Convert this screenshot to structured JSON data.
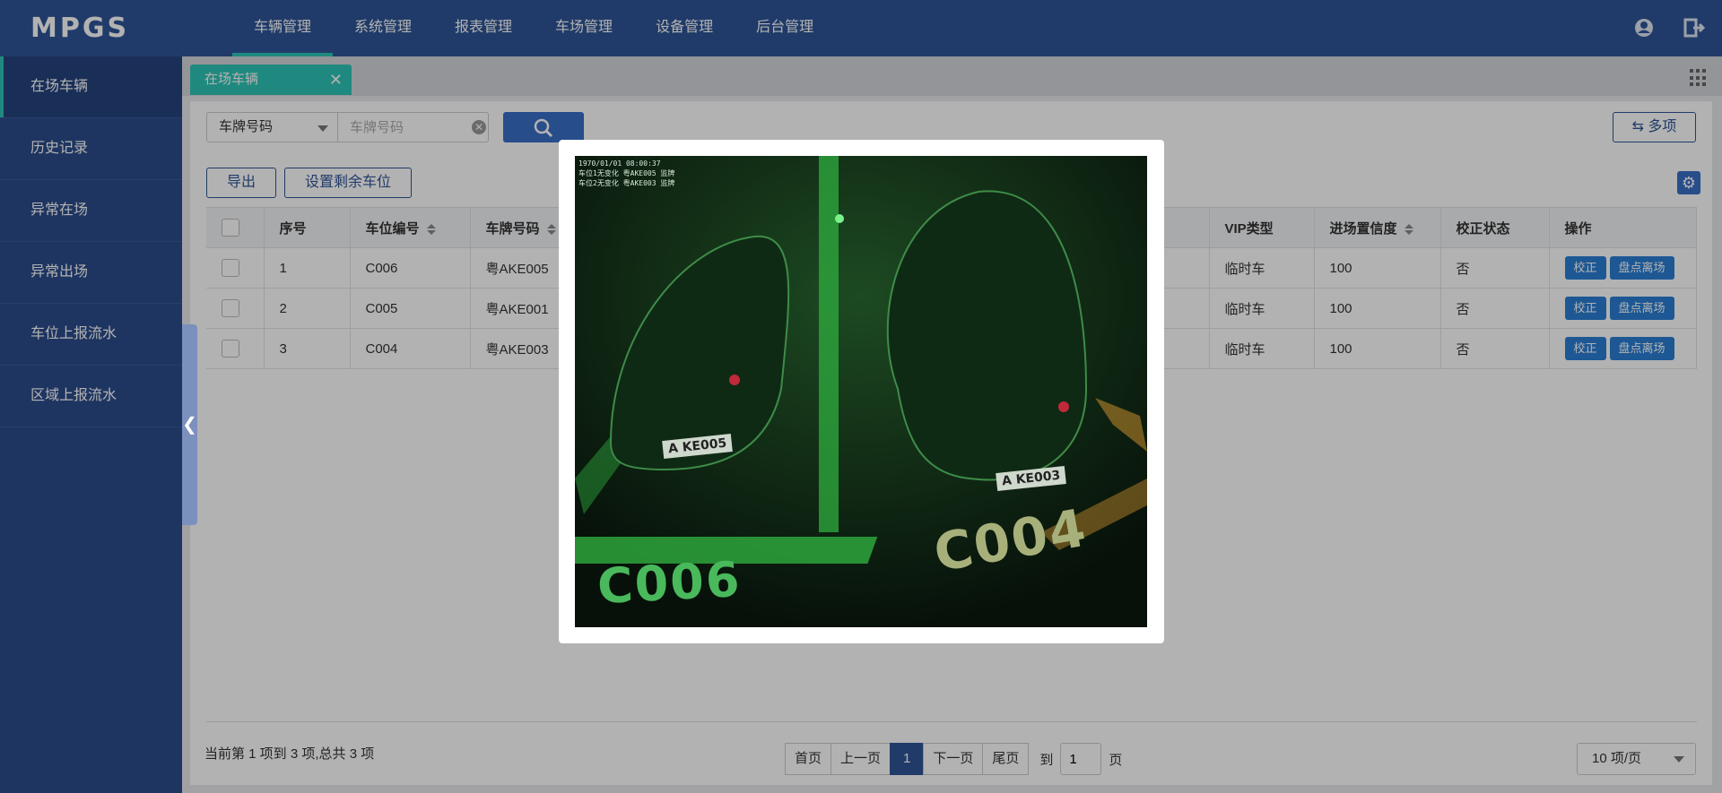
{
  "app": {
    "logo": "MPGS"
  },
  "topnav": {
    "items": [
      {
        "label": "车辆管理",
        "active": true
      },
      {
        "label": "系统管理"
      },
      {
        "label": "报表管理"
      },
      {
        "label": "车场管理"
      },
      {
        "label": "设备管理"
      },
      {
        "label": "后台管理"
      }
    ],
    "icons": [
      "user-icon",
      "logout-icon"
    ]
  },
  "sidebar": {
    "items": [
      {
        "label": "在场车辆",
        "active": true
      },
      {
        "label": "历史记录"
      },
      {
        "label": "异常在场"
      },
      {
        "label": "异常出场"
      },
      {
        "label": "车位上报流水"
      },
      {
        "label": "区域上报流水"
      }
    ],
    "collapse_glyph": "❮"
  },
  "tabs": [
    {
      "label": "在场车辆",
      "close": "✕"
    }
  ],
  "search": {
    "field_select": "车牌号码",
    "placeholder": "车牌号码",
    "clear_glyph": "✕",
    "multi_label": "⇆ 多项"
  },
  "toolbar": {
    "export_label": "导出",
    "set_remaining_label": "设置剩余车位",
    "gear_glyph": "⚙"
  },
  "table": {
    "columns": [
      "序号",
      "车位编号",
      "车牌号码",
      "VIP类型",
      "进场置信度",
      "校正状态",
      "操作"
    ],
    "rows": [
      {
        "index": "1",
        "space": "C006",
        "plate": "粤AKE005",
        "vip": "临时车",
        "confidence": "100",
        "corrected": "否"
      },
      {
        "index": "2",
        "space": "C005",
        "plate": "粤AKE001",
        "vip": "临时车",
        "confidence": "100",
        "corrected": "否"
      },
      {
        "index": "3",
        "space": "C004",
        "plate": "粤AKE003",
        "vip": "临时车",
        "confidence": "100",
        "corrected": "否"
      }
    ],
    "actions": {
      "correct": "校正",
      "checkout": "盘点离场"
    }
  },
  "footer": {
    "summary": "当前第 1 项到 3 项,总共 3 项",
    "pager": {
      "first": "首页",
      "prev": "上一页",
      "current": "1",
      "next": "下一页",
      "last": "尾页"
    },
    "goto_prefix": "到",
    "goto_value": "1",
    "goto_suffix": "页",
    "page_size": "10 项/页"
  },
  "modal": {
    "timestamp": "1970/01/01 08:00:37",
    "overlay_line1": "车位1无变化 粤AKE005 监牌",
    "overlay_line2": "车位2无变化 粤AKE003 监牌",
    "space_label_left": "C006",
    "space_label_right": "C004",
    "plate_left": "A KE005",
    "plate_right": "A KE003"
  }
}
